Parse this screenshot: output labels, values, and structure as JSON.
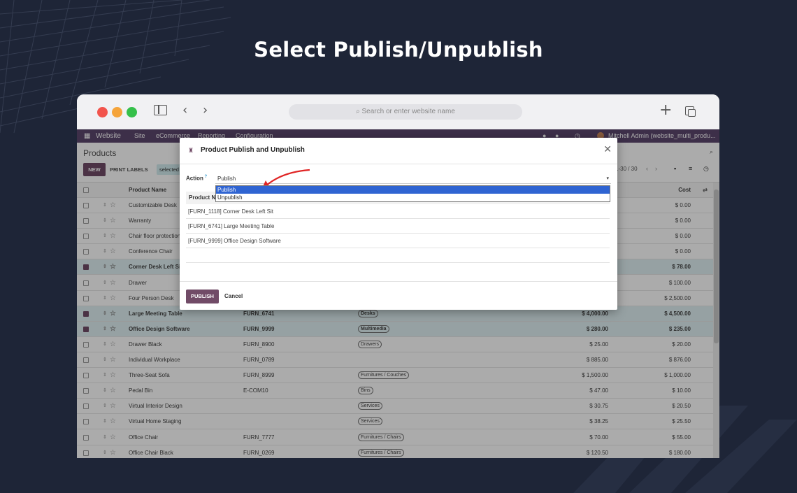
{
  "heading": "Select Publish/Unpublish",
  "browser": {
    "url_placeholder": "Search or enter website name"
  },
  "navbar": {
    "app": "Website",
    "menu": [
      "Site",
      "eCommerce",
      "Reporting",
      "Configuration"
    ],
    "user": "Mitchell Admin (website_multi_produ..."
  },
  "control_panel": {
    "title": "Products",
    "new_label": "NEW",
    "print_label": "PRINT LABELS",
    "selected_label": "selected",
    "pager": "1-30 / 30"
  },
  "table": {
    "header": {
      "name": "Product Name",
      "cost": "Cost"
    },
    "rows": [
      {
        "name": "Customizable Desk",
        "ref": "",
        "tag": "",
        "price": "",
        "cost": "$ 0.00",
        "selected": false
      },
      {
        "name": "Warranty",
        "ref": "",
        "tag": "",
        "price": "",
        "cost": "$ 0.00",
        "selected": false
      },
      {
        "name": "Chair floor protection",
        "ref": "",
        "tag": "",
        "price": "",
        "cost": "$ 0.00",
        "selected": false
      },
      {
        "name": "Conference Chair",
        "ref": "",
        "tag": "",
        "price": "",
        "cost": "$ 0.00",
        "selected": false
      },
      {
        "name": "Corner Desk Left Sit",
        "ref": "",
        "tag": "",
        "price": "",
        "cost": "$ 78.00",
        "selected": true
      },
      {
        "name": "Drawer",
        "ref": "",
        "tag": "",
        "price": "",
        "cost": "$ 100.00",
        "selected": false
      },
      {
        "name": "Four Person Desk",
        "ref": "",
        "tag": "",
        "price": "",
        "cost": "$ 2,500.00",
        "selected": false
      },
      {
        "name": "Large Meeting Table",
        "ref": "FURN_6741",
        "tag": "Desks",
        "price": "$ 4,000.00",
        "cost": "$ 4,500.00",
        "selected": true
      },
      {
        "name": "Office Design Software",
        "ref": "FURN_9999",
        "tag": "Multimedia",
        "price": "$ 280.00",
        "cost": "$ 235.00",
        "selected": true
      },
      {
        "name": "Drawer Black",
        "ref": "FURN_8900",
        "tag": "Drawers",
        "price": "$ 25.00",
        "cost": "$ 20.00",
        "selected": false
      },
      {
        "name": "Individual Workplace",
        "ref": "FURN_0789",
        "tag": "",
        "price": "$ 885.00",
        "cost": "$ 876.00",
        "selected": false
      },
      {
        "name": "Three-Seat Sofa",
        "ref": "FURN_8999",
        "tag": "Furnitures / Couches",
        "price": "$ 1,500.00",
        "cost": "$ 1,000.00",
        "selected": false
      },
      {
        "name": "Pedal Bin",
        "ref": "E-COM10",
        "tag": "Bins",
        "price": "$ 47.00",
        "cost": "$ 10.00",
        "selected": false
      },
      {
        "name": "Virtual Interior Design",
        "ref": "",
        "tag": "Services",
        "price": "$ 30.75",
        "cost": "$ 20.50",
        "selected": false
      },
      {
        "name": "Virtual Home Staging",
        "ref": "",
        "tag": "Services",
        "price": "$ 38.25",
        "cost": "$ 25.50",
        "selected": false
      },
      {
        "name": "Office Chair",
        "ref": "FURN_7777",
        "tag": "Furnitures / Chairs",
        "price": "$ 70.00",
        "cost": "$ 55.00",
        "selected": false
      },
      {
        "name": "Office Chair Black",
        "ref": "FURN_0269",
        "tag": "Furnitures / Chairs",
        "price": "$ 120.50",
        "cost": "$ 180.00",
        "selected": false
      }
    ]
  },
  "modal": {
    "title": "Product Publish and Unpublish",
    "action_label": "Action",
    "action_value": "Publish",
    "options": [
      "Publish",
      "Unpublish"
    ],
    "sub_header": "Product Name",
    "products": [
      "[FURN_1118] Corner Desk Left Sit",
      "[FURN_6741] Large Meeting Table",
      "[FURN_9999] Office Design Software"
    ],
    "publish_label": "PUBLISH",
    "cancel_label": "Cancel"
  },
  "colors": {
    "brand": "#714b67",
    "navbar": "#5b466e",
    "highlight": "#2f64d2",
    "arrow": "#e02424"
  }
}
